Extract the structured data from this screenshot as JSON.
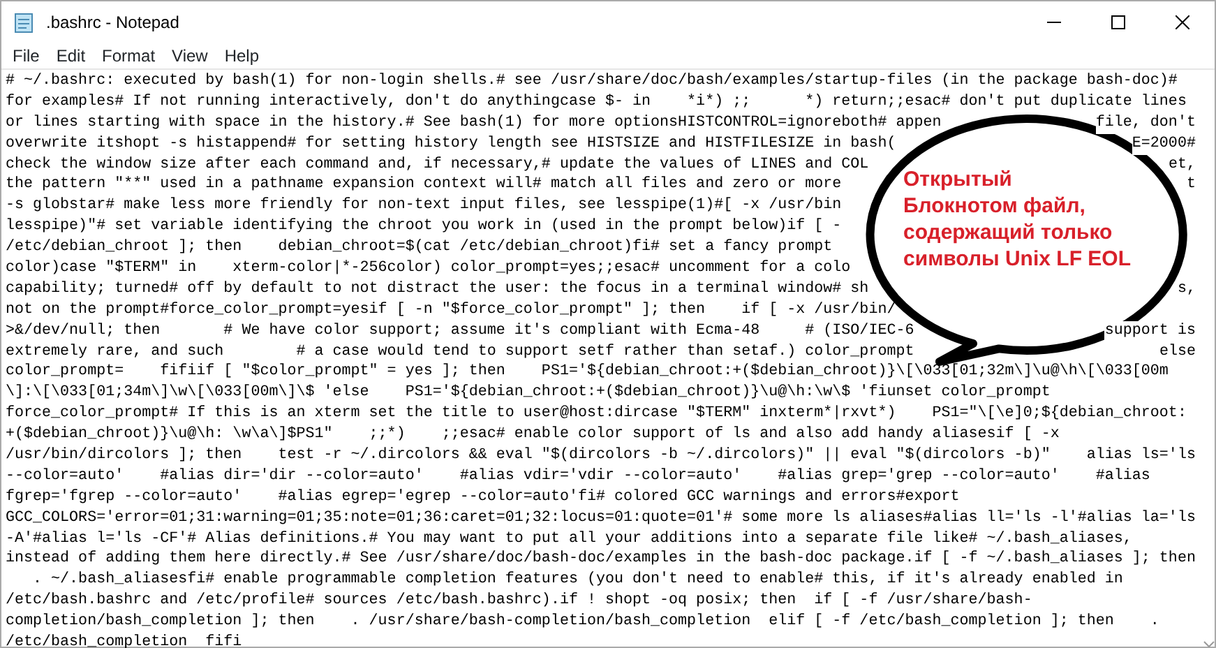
{
  "window": {
    "title": ".bashrc - Notepad"
  },
  "menu": [
    "File",
    "Edit",
    "Format",
    "View",
    "Help"
  ],
  "lines": [
    {
      "text": "# ~/.bashrc: executed by bash(1) for non-login shells.# see /usr/share/doc/bash/examples/startup-files (in the package bash-doc)#"
    },
    {
      "text": "for examples# If not running interactively, don't do anythingcase $- in    *i*) ;;      *) return;;esac# don't put duplicate lines"
    },
    {
      "text": "or lines starting with space in the history.# See bash(1) for more optionsHISTCONTROL=ignoreboth# appen",
      "tail": "file, don't"
    },
    {
      "text": "overwrite itshopt -s histappend# for setting history length see HISTSIZE and HISTFILESIZE in bash(",
      "tail": "E=2000#"
    },
    {
      "text": "check the window size after each command and, if necessary,# update the values of LINES and COL",
      "tail": "et,"
    },
    {
      "text": "the pattern \"**\" used in a pathname expansion context will# match all files and zero or more",
      "tail": "t"
    },
    {
      "text": "-s globstar# make less more friendly for non-text input files, see lesspipe(1)#[ -x /usr/bin"
    },
    {
      "text": "lesspipe)\"# set variable identifying the chroot you work in (used in the prompt below)if [ -"
    },
    {
      "text": "/etc/debian_chroot ]; then    debian_chroot=$(cat /etc/debian_chroot)fi# set a fancy prompt"
    },
    {
      "text": "color)case \"$TERM\" in    xterm-color|*-256color) color_prompt=yes;;esac# uncomment for a colo"
    },
    {
      "text": "capability; turned# off by default to not distract the user: the focus in a terminal window# sh",
      "tail": "s,"
    },
    {
      "text": "not on the prompt#force_color_prompt=yesif [ -n \"$force_color_prompt\" ]; then    if [ -x /usr/bin/"
    },
    {
      "text": ">&/dev/null; then       # We have color support; assume it's compliant with Ecma-48     # (ISO/IEC-6",
      "tail": "support is"
    },
    {
      "text": "extremely rare, and such        # a case would tend to support setf rather than setaf.) color_prompt",
      "tail": "else"
    },
    {
      "text": "color_prompt=    fifiif [ \"$color_prompt\" = yes ]; then    PS1='${debian_chroot:+($debian_chroot)}\\[\\033[01;32m\\]\\u@\\h\\[\\033[00m"
    },
    {
      "text": "\\]:\\[\\033[01;34m\\]\\w\\[\\033[00m\\]\\$ 'else    PS1='${debian_chroot:+($debian_chroot)}\\u@\\h:\\w\\$ 'fiunset color_prompt"
    },
    {
      "text": "force_color_prompt# If this is an xterm set the title to user@host:dircase \"$TERM\" inxterm*|rxvt*)    PS1=\"\\[\\e]0;${debian_chroot:"
    },
    {
      "text": "+($debian_chroot)}\\u@\\h: \\w\\a\\]$PS1\"    ;;*)    ;;esac# enable color support of ls and also add handy aliasesif [ -x"
    },
    {
      "text": "/usr/bin/dircolors ]; then    test -r ~/.dircolors && eval \"$(dircolors -b ~/.dircolors)\" || eval \"$(dircolors -b)\"    alias ls='ls"
    },
    {
      "text": "--color=auto'    #alias dir='dir --color=auto'    #alias vdir='vdir --color=auto'    #alias grep='grep --color=auto'    #alias"
    },
    {
      "text": "fgrep='fgrep --color=auto'    #alias egrep='egrep --color=auto'fi# colored GCC warnings and errors#export"
    },
    {
      "text": "GCC_COLORS='error=01;31:warning=01;35:note=01;36:caret=01;32:locus=01:quote=01'# some more ls aliases#alias ll='ls -l'#alias la='ls"
    },
    {
      "text": "-A'#alias l='ls -CF'# Alias definitions.# You may want to put all your additions into a separate file like# ~/.bash_aliases,"
    },
    {
      "text": "instead of adding them here directly.# See /usr/share/doc/bash-doc/examples in the bash-doc package.if [ -f ~/.bash_aliases ]; then"
    },
    {
      "text": "   . ~/.bash_aliasesfi# enable programmable completion features (you don't need to enable# this, if it's already enabled in"
    },
    {
      "text": "/etc/bash.bashrc and /etc/profile# sources /etc/bash.bashrc).if ! shopt -oq posix; then  if [ -f /usr/share/bash-"
    },
    {
      "text": "completion/bash_completion ]; then    . /usr/share/bash-completion/bash_completion  elif [ -f /etc/bash_completion ]; then    ."
    },
    {
      "text": "/etc/bash_completion  fifi"
    }
  ],
  "callout": {
    "lines": [
      "Открытый",
      "Блокнотом файл,",
      "содержащий только",
      "символы Unix LF EOL"
    ]
  }
}
